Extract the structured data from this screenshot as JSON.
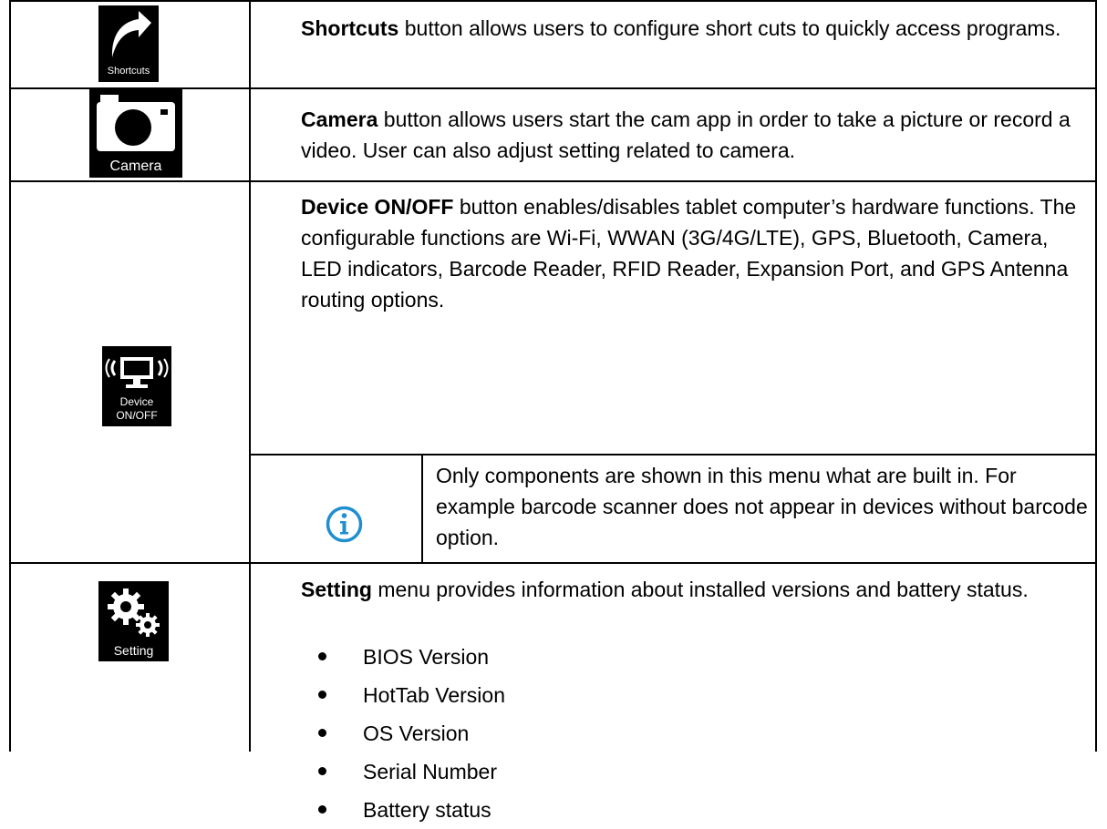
{
  "rows": [
    {
      "icon": {
        "name": "shortcuts-icon",
        "label": "Shortcuts"
      },
      "title": "Shortcuts",
      "text": " button allows users to configure short cuts to quickly access programs."
    },
    {
      "icon": {
        "name": "camera-icon",
        "label": "Camera"
      },
      "title": "Camera",
      "text": " button allows users start the cam app in order to take a picture or record a video. User can also adjust setting related to camera."
    },
    {
      "icon": {
        "name": "device-onoff-icon",
        "label_line1": "Device",
        "label_line2": "ON/OFF"
      },
      "title": "Device ON/OFF",
      "text": " button enables/disables tablet computer’s hardware functions. The configurable functions are Wi-Fi, WWAN (3G/4G/LTE), GPS, Bluetooth, Camera, LED indicators, Barcode Reader, RFID Reader, Expansion Port, and GPS Antenna routing options.",
      "note": "Only components are shown in this menu what are built in. For example barcode scanner does not appear in devices without barcode option."
    },
    {
      "icon": {
        "name": "setting-icon",
        "label": "Setting"
      },
      "title": "Setting",
      "text": " menu provides information about installed versions and battery status.",
      "bullets": [
        "BIOS Version",
        "HotTab Version",
        "OS Version",
        "Serial Number",
        "Battery status"
      ]
    }
  ],
  "colors": {
    "tile": "#000000",
    "info": "#1f8fcf"
  }
}
